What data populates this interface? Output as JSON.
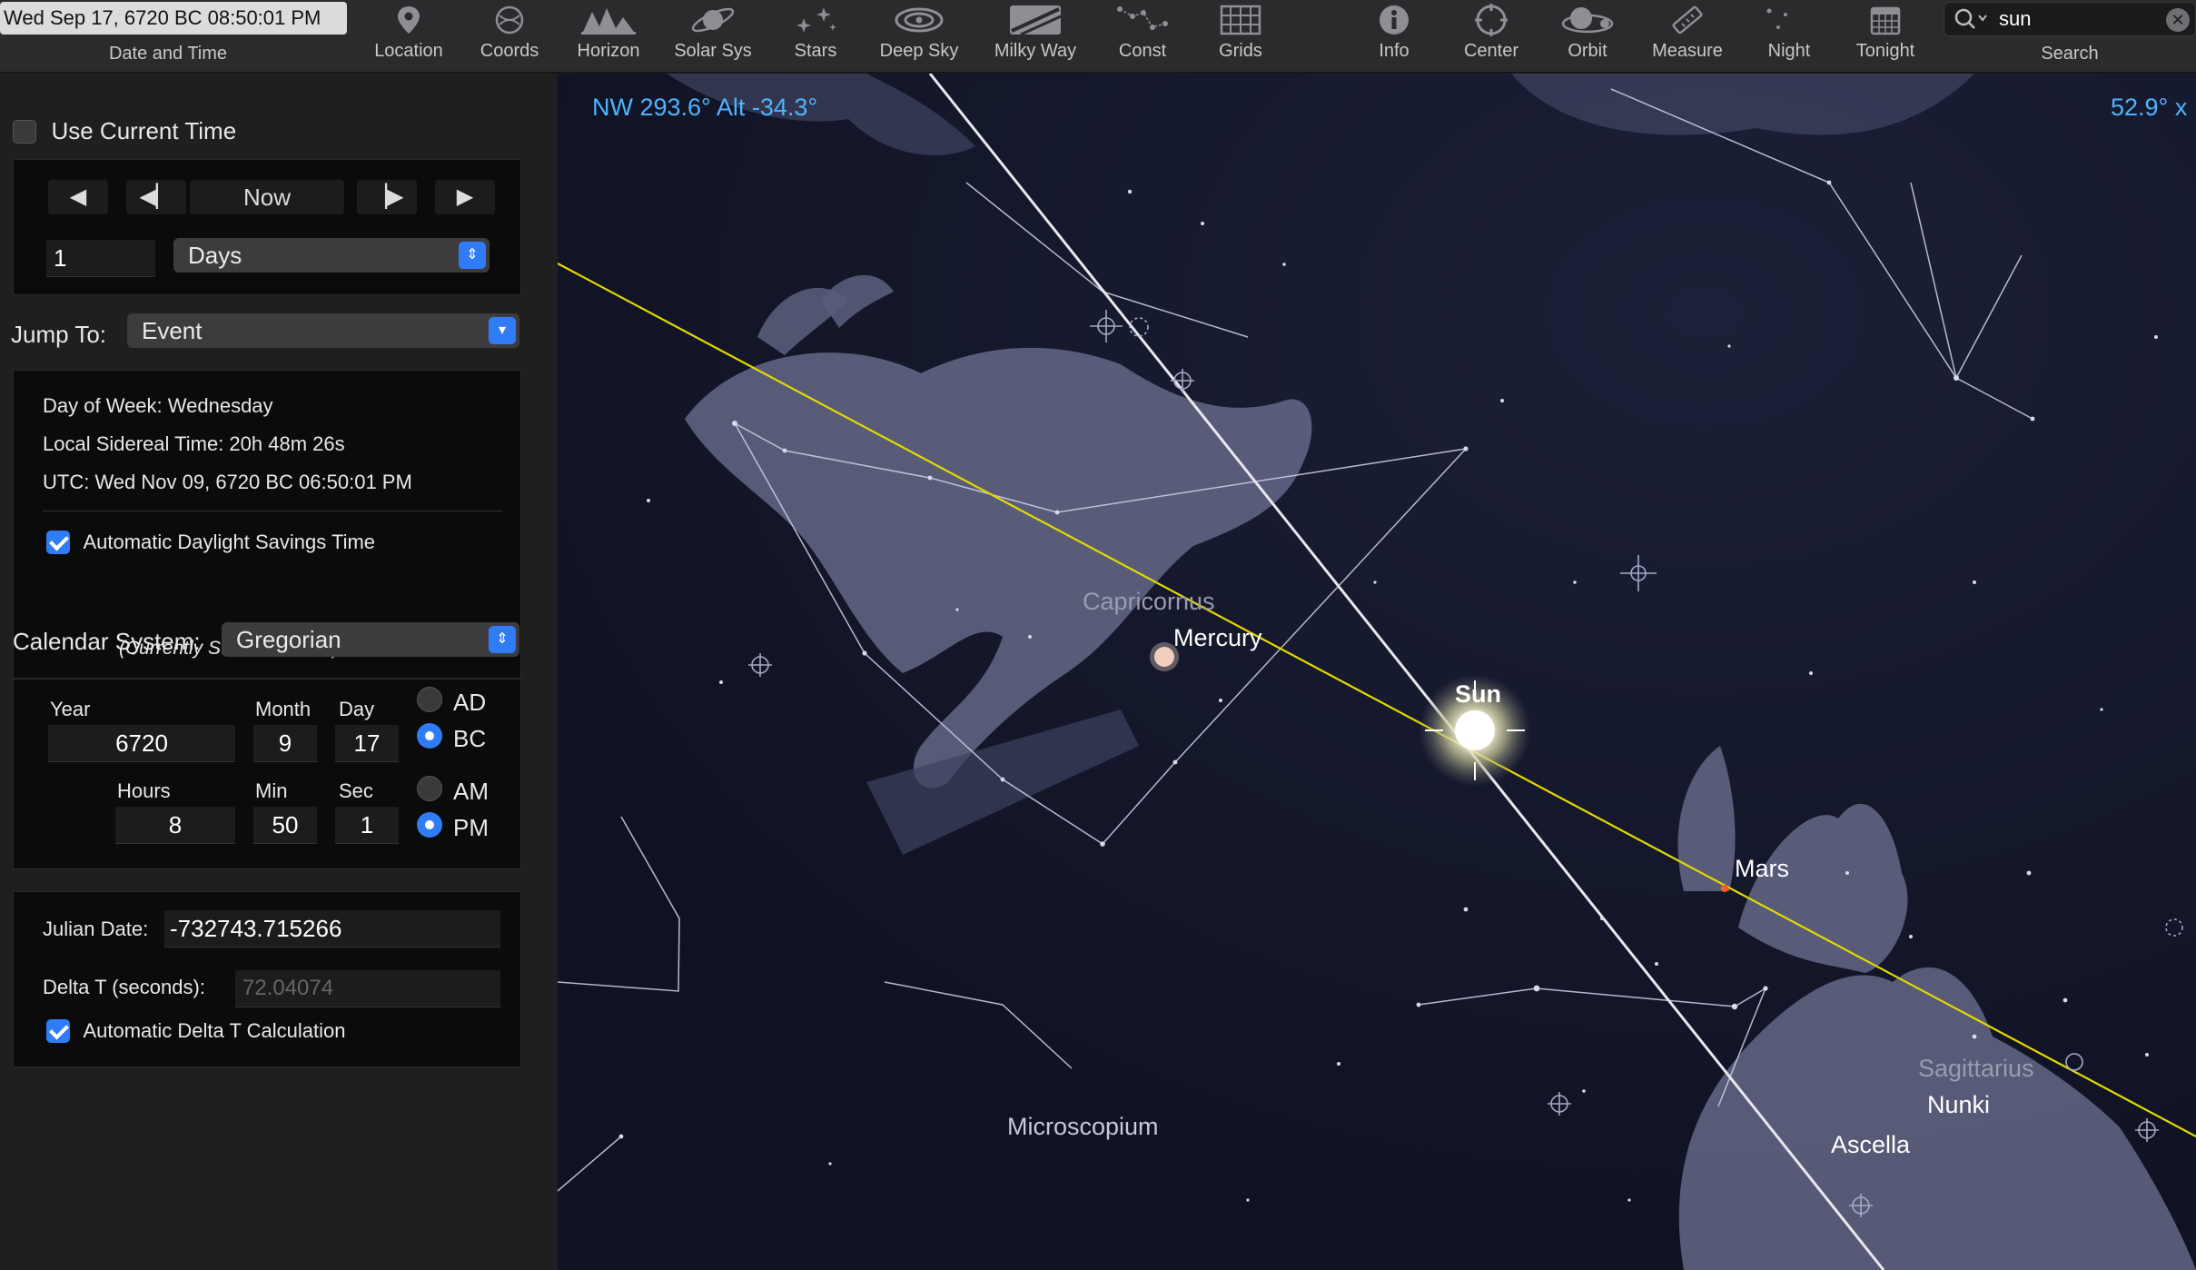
{
  "toolbar": {
    "datetime": "Wed Sep 17, 6720 BC 08:50:01 PM",
    "datetime_label": "Date and Time",
    "tools": [
      {
        "label": "Location",
        "icon": "location-pin-icon"
      },
      {
        "label": "Coords",
        "icon": "coords-icon"
      },
      {
        "label": "Horizon",
        "icon": "horizon-icon"
      },
      {
        "label": "Solar Sys",
        "icon": "planet-icon"
      },
      {
        "label": "Stars",
        "icon": "stars-icon"
      },
      {
        "label": "Deep Sky",
        "icon": "galaxy-icon"
      },
      {
        "label": "Milky Way",
        "icon": "milky-way-icon"
      },
      {
        "label": "Const",
        "icon": "constellation-icon"
      },
      {
        "label": "Grids",
        "icon": "grid-icon"
      },
      {
        "label": "Info",
        "icon": "info-icon"
      },
      {
        "label": "Center",
        "icon": "center-icon"
      },
      {
        "label": "Orbit",
        "icon": "orbit-icon"
      },
      {
        "label": "Measure",
        "icon": "ruler-icon"
      },
      {
        "label": "Night",
        "icon": "moon-icon"
      },
      {
        "label": "Tonight",
        "icon": "calendar-icon"
      }
    ],
    "search": {
      "value": "sun",
      "label": "Search"
    }
  },
  "panel": {
    "use_current_time": "Use Current Time",
    "now_label": "Now",
    "step_value": "1",
    "step_unit": "Days",
    "jump_to_label": "Jump To:",
    "jump_to_value": "Event",
    "info": {
      "day_of_week": "Day of Week:  Wednesday",
      "sidereal": "Local Sidereal Time:  20h 48m 26s",
      "utc": "UTC:  Wed Nov 09, 6720 BC 06:50:01 PM",
      "dst_label": "Automatic Daylight Savings Time",
      "dst_note": "(Currently Standard Time)"
    },
    "calendar_label": "Calendar System:",
    "calendar_value": "Gregorian",
    "date": {
      "year_label": "Year",
      "year": "6720",
      "month_label": "Month",
      "month": "9",
      "day_label": "Day",
      "day": "17",
      "hours_label": "Hours",
      "hours": "8",
      "min_label": "Min",
      "min": "50",
      "sec_label": "Sec",
      "sec": "1",
      "ad": "AD",
      "bc": "BC",
      "am": "AM",
      "pm": "PM"
    },
    "julian_label": "Julian Date:",
    "julian_value": "-732743.715266",
    "deltat_label": "Delta T (seconds):",
    "deltat_value": "72.04074",
    "auto_deltat": "Automatic Delta T Calculation"
  },
  "sky": {
    "direction": "NW 293.6° Alt -34.3°",
    "fov": "52.9° x",
    "labels": {
      "capricornus": "Capricornus",
      "mercury": "Mercury",
      "sun": "Sun",
      "mars": "Mars",
      "microscopium": "Microscopium",
      "sagittarius": "Sagittarius",
      "nunki": "Nunki",
      "ascella": "Ascella"
    },
    "colors": {
      "ecliptic": "#e6d800",
      "accent": "#4fb3ff",
      "background": "#111425"
    }
  }
}
